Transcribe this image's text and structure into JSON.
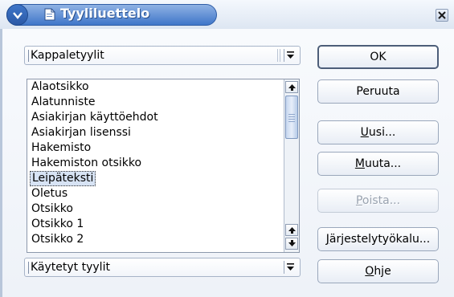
{
  "window": {
    "title": "Tyyliluettelo",
    "menu_icon": "chevron-down-circle-icon",
    "close_icon": "close-icon"
  },
  "category_select": {
    "value": "Kappaletyylit"
  },
  "style_list": {
    "items": [
      {
        "label": "Alaotsikko"
      },
      {
        "label": "Alatunniste"
      },
      {
        "label": "Asiakirjan käyttöehdot"
      },
      {
        "label": "Asiakirjan lisenssi"
      },
      {
        "label": "Hakemisto"
      },
      {
        "label": "Hakemiston otsikko"
      },
      {
        "label": "Leipäteksti",
        "selected": true
      },
      {
        "label": "Oletus"
      },
      {
        "label": "Otsikko"
      },
      {
        "label": "Otsikko 1"
      },
      {
        "label": "Otsikko 2"
      }
    ]
  },
  "filter_select": {
    "value": "Käytetyt tyylit"
  },
  "buttons": {
    "ok": {
      "label": "OK"
    },
    "cancel": {
      "label": "Peruuta"
    },
    "new": {
      "label": "Uusi...",
      "mnemonic": "U",
      "rest": "usi..."
    },
    "modify": {
      "label": "Muuta...",
      "mnemonic": "M",
      "rest": "uuta..."
    },
    "delete": {
      "label": "Poista...",
      "mnemonic": "P",
      "rest": "oista...",
      "disabled": true
    },
    "organizer": {
      "label": "Järjestelytyökalu...",
      "mnemonic": "J",
      "rest": "ärjestelytyökalu..."
    },
    "help": {
      "label": "Ohje",
      "mnemonic": "O",
      "rest": "hje"
    }
  },
  "colors": {
    "title_bar": "#3f76c9",
    "selection": "#d7e3f4",
    "disabled_text": "#9aa3b0"
  }
}
